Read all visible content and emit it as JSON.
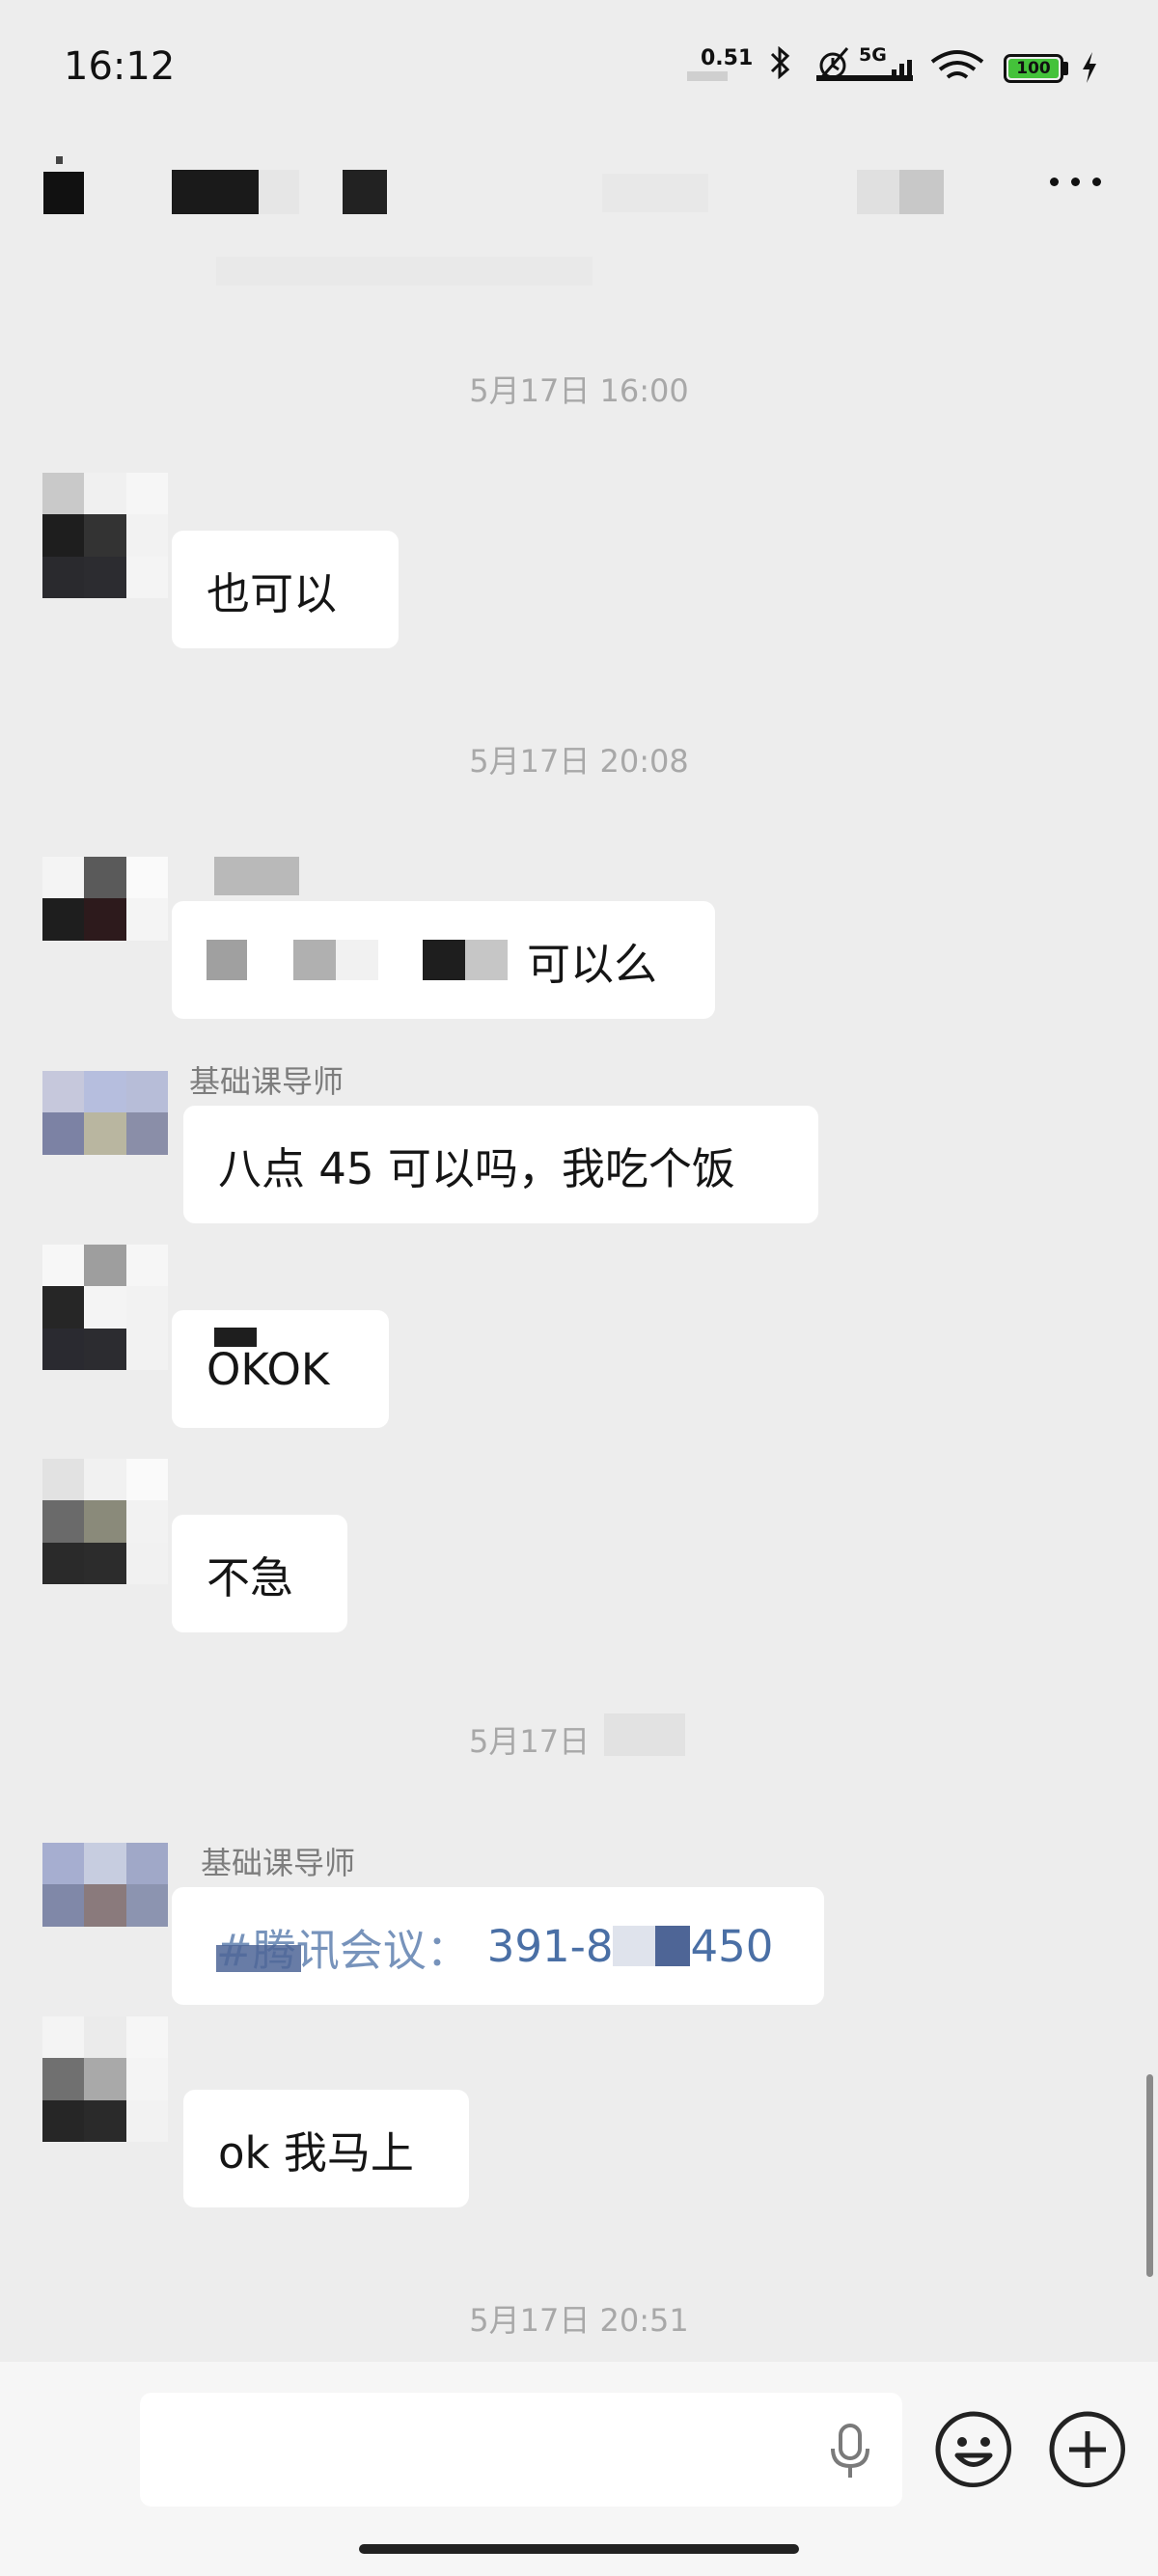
{
  "status_bar": {
    "time": "16:12",
    "net_speed": "0.51",
    "signal_label": "5G",
    "battery": "100",
    "icons": [
      "bluetooth-icon",
      "alarm-icon",
      "signal-icon",
      "wifi-icon",
      "battery-icon",
      "charging-icon"
    ]
  },
  "header": {
    "icons": [
      "more-options-icon"
    ]
  },
  "messages": {
    "ts1": "5月17日 16:00",
    "m1_text": "也可以",
    "ts2": "5月17日 20:08",
    "m2_text": "可以么",
    "m3_sender": "基础课导师",
    "m3_text": "八点 45 可以吗，我吃个饭",
    "m4_text": "OKOK",
    "m5_text": "不急",
    "ts3": "5月17日 ",
    "m6_sender": "基础课导师",
    "m6_text_a": "#腾讯会议：",
    "m6_text_b": "391-8",
    "m6_text_c": "450",
    "m7_text": "ok 我马上",
    "ts4": "5月17日 20:51"
  },
  "input": {
    "placeholder": ""
  },
  "colors": {
    "background": "#ededed",
    "bubble": "#ffffff",
    "link": "#4a6fa5",
    "battery": "#44c23a"
  }
}
